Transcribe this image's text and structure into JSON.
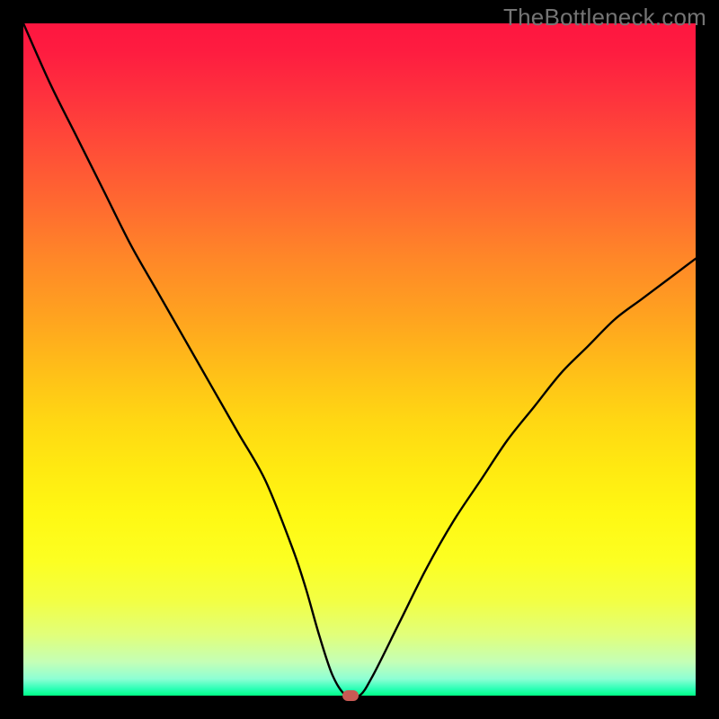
{
  "watermark": "TheBottleneck.com",
  "chart_data": {
    "type": "line",
    "title": "",
    "xlabel": "",
    "ylabel": "",
    "xlim": [
      0,
      100
    ],
    "ylim": [
      0,
      100
    ],
    "x": [
      0,
      4,
      8,
      12,
      16,
      20,
      24,
      28,
      32,
      36,
      40,
      42,
      44,
      46,
      48,
      50,
      52,
      56,
      60,
      64,
      68,
      72,
      76,
      80,
      84,
      88,
      92,
      96,
      100
    ],
    "y": [
      100,
      91,
      83,
      75,
      67,
      60,
      53,
      46,
      39,
      32,
      22,
      16,
      9,
      3,
      0,
      0,
      3,
      11,
      19,
      26,
      32,
      38,
      43,
      48,
      52,
      56,
      59,
      62,
      65
    ],
    "marker": {
      "x": 48.6,
      "y": 0
    },
    "background_gradient": {
      "top": "#fe1640",
      "mid": "#ffe911",
      "bottom": "#00ff86"
    }
  }
}
